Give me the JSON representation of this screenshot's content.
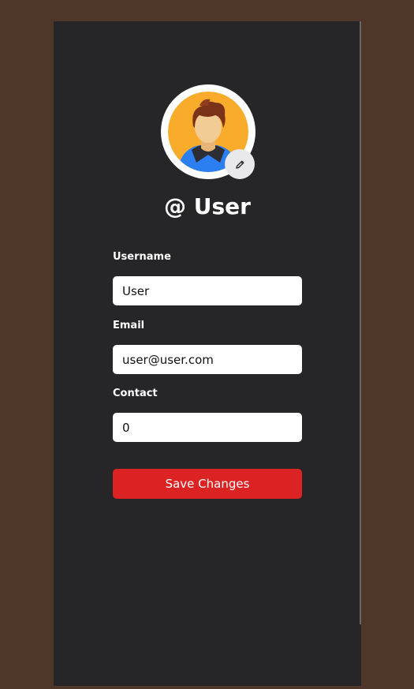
{
  "profile": {
    "handle": "@ User",
    "avatar_icon": "user-avatar-icon",
    "edit_icon": "pencil-icon"
  },
  "form": {
    "username_label": "Username",
    "username_value": "User",
    "email_label": "Email",
    "email_value": "user@user.com",
    "contact_label": "Contact",
    "contact_value": "0",
    "save_label": "Save Changes"
  },
  "colors": {
    "background": "#4e3628",
    "panel": "#262628",
    "accent": "#dc2323",
    "avatar_bg": "#f9ab2b",
    "avatar_shirt": "#2b7ff0"
  }
}
